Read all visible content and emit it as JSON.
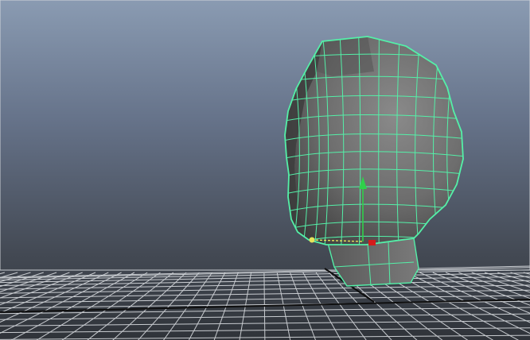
{
  "viewport": {
    "background_top": "#8395ad",
    "background_mid": "#5a6575",
    "background_bottom": "#2e3238",
    "grid_color": "#d9dce0",
    "grid_axis_color": "#111111",
    "wire_color": "#54f0a8",
    "mesh_shade": "#6a6a6a"
  },
  "selection": {
    "object": "head-mesh",
    "manipulator": "move-tool"
  },
  "icons": {
    "y_axis": "green-arrow-icon",
    "x_axis": "yellow-axis-line",
    "center": "red-pivot-icon"
  }
}
